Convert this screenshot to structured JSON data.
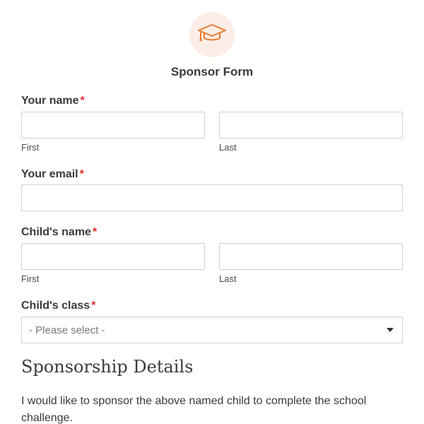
{
  "header": {
    "icon": "graduation-cap-icon",
    "title": "Sponsor Form",
    "accent_color": "#e8792f",
    "icon_background": "#fbeee7"
  },
  "required_marker": "*",
  "required_color": "#e02d2d",
  "fields": {
    "your_name": {
      "label": "Your name",
      "first": {
        "value": "",
        "sublabel": "First"
      },
      "last": {
        "value": "",
        "sublabel": "Last"
      }
    },
    "your_email": {
      "label": "Your email",
      "value": ""
    },
    "childs_name": {
      "label": "Child's name",
      "first": {
        "value": "",
        "sublabel": "First"
      },
      "last": {
        "value": "",
        "sublabel": "Last"
      }
    },
    "childs_class": {
      "label": "Child's class",
      "selected": "- Please select -"
    }
  },
  "section": {
    "title": "Sponsorship Details",
    "paragraph": "I would like to sponsor the above named child to complete the school challenge."
  }
}
